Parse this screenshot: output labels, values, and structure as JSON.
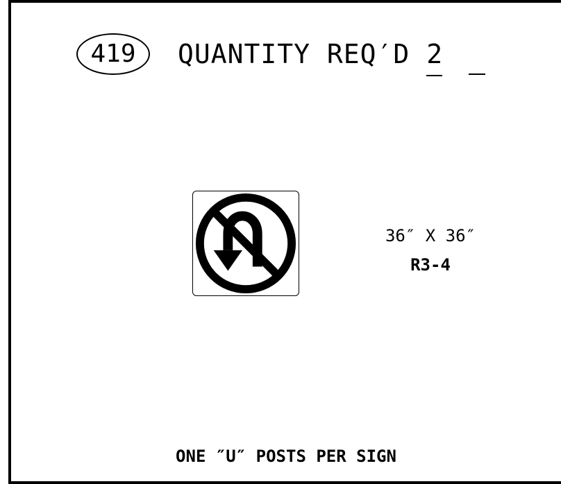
{
  "header": {
    "item_number": "419",
    "quantity_label": "QUANTITY REQ′D",
    "quantity_value": "2"
  },
  "sign": {
    "icon": "no-u-turn-icon",
    "size": "36″ X 36″",
    "code": "R3-4"
  },
  "footer": {
    "note": "ONE ″U″ POSTS PER SIGN"
  },
  "colors": {
    "ink": "#000000",
    "paper": "#ffffff"
  }
}
